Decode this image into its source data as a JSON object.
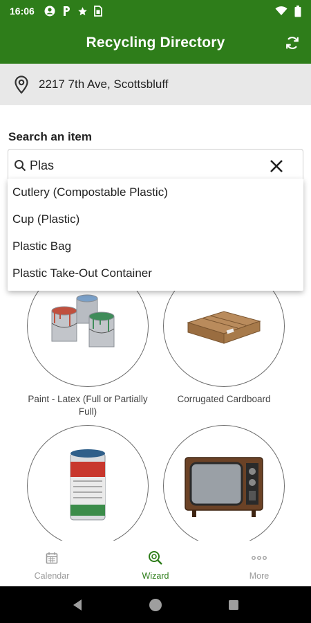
{
  "status_bar": {
    "time": "16:06",
    "icons": [
      "account-circle-icon",
      "parking-icon",
      "star-icon",
      "sim-card-icon"
    ],
    "right_icons": [
      "wifi-icon",
      "battery-icon"
    ]
  },
  "app_bar": {
    "title": "Recycling Directory",
    "refresh_icon": "refresh-icon"
  },
  "location": {
    "address": "2217 7th Ave, Scottsbluff",
    "icon": "location-pin-icon"
  },
  "search": {
    "label": "Search an item",
    "query": "Plas",
    "icon": "search-icon",
    "clear_icon": "close-icon"
  },
  "suggestions": [
    "Cutlery (Compostable Plastic)",
    "Cup (Plastic)",
    "Plastic Bag",
    "Plastic Take-Out Container"
  ],
  "items": [
    {
      "label": "Paint - Latex (Full or Partially Full)",
      "icon": "paint-cans-icon"
    },
    {
      "label": "Corrugated Cardboard",
      "icon": "cardboard-box-icon"
    },
    {
      "label": "",
      "icon": "aerosol-can-icon"
    },
    {
      "label": "",
      "icon": "television-icon"
    }
  ],
  "bottom_nav": [
    {
      "label": "Calendar",
      "icon": "calendar-icon",
      "active": false
    },
    {
      "label": "Wizard",
      "icon": "wizard-search-icon",
      "active": true
    },
    {
      "label": "More",
      "icon": "more-dots-icon",
      "active": false
    }
  ],
  "colors": {
    "primary": "#2e7d1a",
    "location_bg": "#e8e8e8",
    "nav_inactive": "#9a9a9a"
  }
}
